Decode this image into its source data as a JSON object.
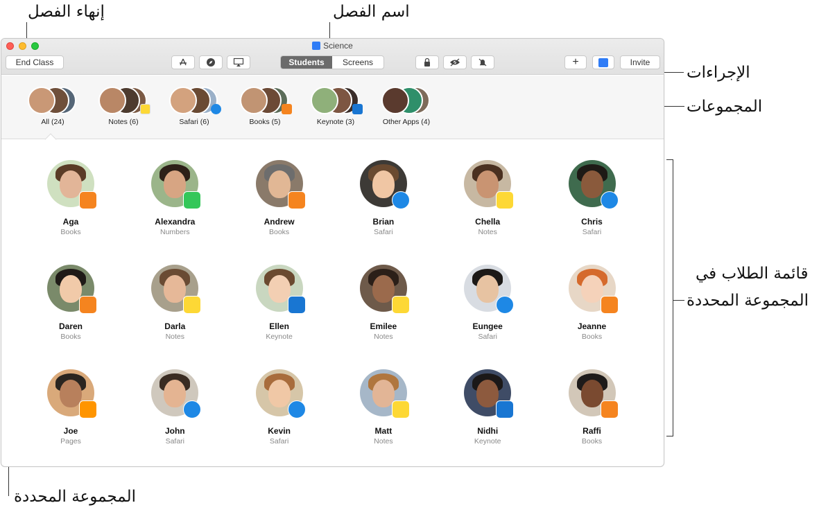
{
  "callouts": {
    "end_class": "إنهاء الفصل",
    "class_name": "اسم الفصل",
    "actions": "الإجراءات",
    "groups": "المجموعات",
    "student_list_line1": "قائمة الطلاب في",
    "student_list_line2": "المجموعة المحددة",
    "selected_group": "المجموعة المحددة"
  },
  "window": {
    "title": "Science"
  },
  "toolbar": {
    "end_class": "End Class",
    "tabs": [
      "Students",
      "Screens"
    ],
    "active_tab": "Students",
    "invite": "Invite",
    "add": "+",
    "icons": [
      "app-store-icon",
      "safari-icon",
      "airplay-icon",
      "lock-icon",
      "eye-icon",
      "mute-icon",
      "teacher-icon"
    ]
  },
  "groups": [
    {
      "label": "All (24)",
      "badge": "",
      "selected": true
    },
    {
      "label": "Notes (6)",
      "badge": "notes"
    },
    {
      "label": "Safari (6)",
      "badge": "safari"
    },
    {
      "label": "Books (5)",
      "badge": "books"
    },
    {
      "label": "Keynote (3)",
      "badge": "keynote"
    },
    {
      "label": "Other Apps (4)",
      "badge": ""
    }
  ],
  "students": [
    {
      "name": "Aga",
      "app": "Books"
    },
    {
      "name": "Alexandra",
      "app": "Numbers"
    },
    {
      "name": "Andrew",
      "app": "Books"
    },
    {
      "name": "Brian",
      "app": "Safari"
    },
    {
      "name": "Chella",
      "app": "Notes"
    },
    {
      "name": "Chris",
      "app": "Safari"
    },
    {
      "name": "Daren",
      "app": "Books"
    },
    {
      "name": "Darla",
      "app": "Notes"
    },
    {
      "name": "Ellen",
      "app": "Keynote"
    },
    {
      "name": "Emilee",
      "app": "Notes"
    },
    {
      "name": "Eungee",
      "app": "Safari"
    },
    {
      "name": "Jeanne",
      "app": "Books"
    },
    {
      "name": "Joe",
      "app": "Pages"
    },
    {
      "name": "John",
      "app": "Safari"
    },
    {
      "name": "Kevin",
      "app": "Safari"
    },
    {
      "name": "Matt",
      "app": "Notes"
    },
    {
      "name": "Nidhi",
      "app": "Keynote"
    },
    {
      "name": "Raffi",
      "app": "Books"
    }
  ],
  "app_colors": {
    "Books": "#f5841f",
    "Numbers": "#34c759",
    "Safari": "#1e88e5",
    "Notes": "#fdd835",
    "Keynote": "#1976d2",
    "Pages": "#ff9500"
  }
}
